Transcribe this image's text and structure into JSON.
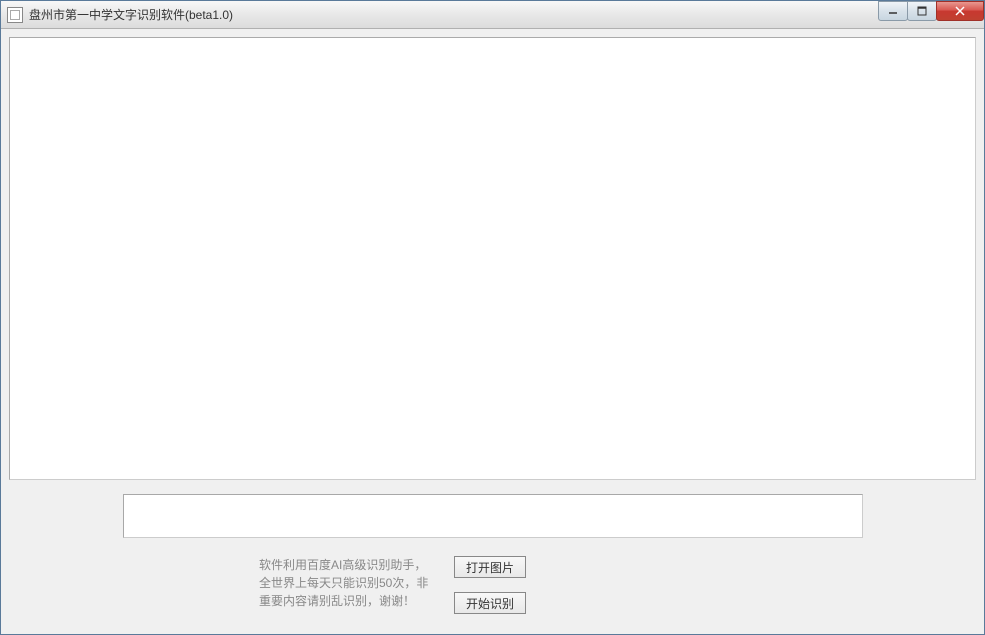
{
  "window": {
    "title": "盘州市第一中学文字识别软件(beta1.0)"
  },
  "info_text": "软件利用百度AI高级识别助手，全世界上每天只能识别50次，非重要内容请别乱识别，谢谢！",
  "buttons": {
    "open_image": "打开图片",
    "start_recognition": "开始识别"
  },
  "text_output": ""
}
